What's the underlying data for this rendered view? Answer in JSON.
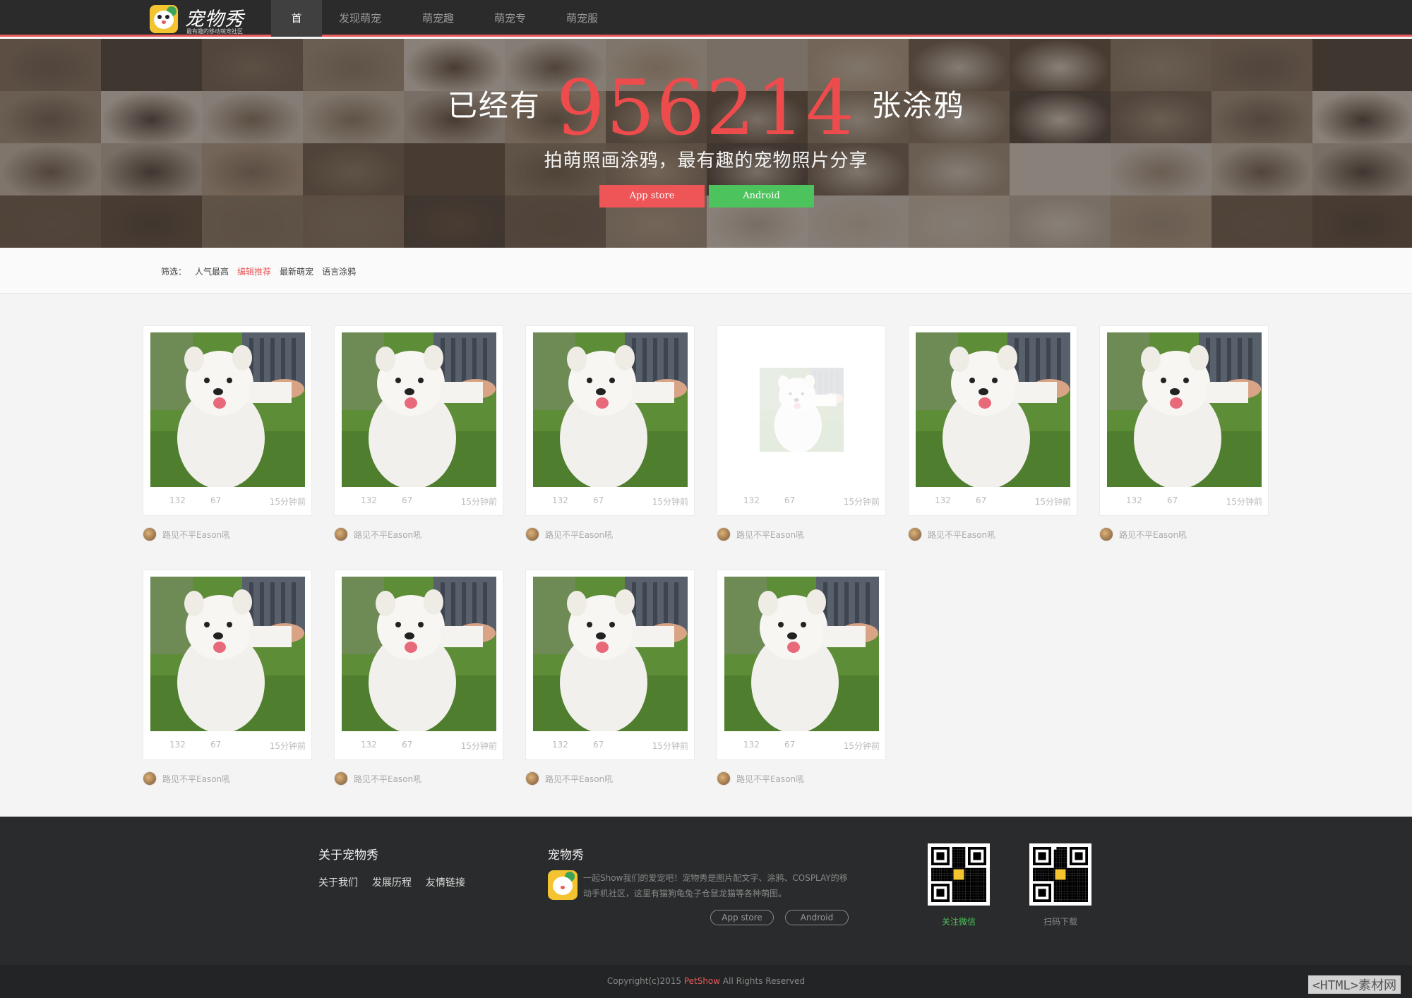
{
  "nav": {
    "logo_title": "宠物秀",
    "logo_sub": "最有趣的移动萌宠社区",
    "items": [
      {
        "label": "首页",
        "active": true
      },
      {
        "label": "发现萌宠"
      },
      {
        "label": "萌宠趣闻"
      },
      {
        "label": "萌宠专题"
      },
      {
        "label": "萌宠服务"
      }
    ],
    "accent": "#e9585a"
  },
  "hero": {
    "prefix": "已经有",
    "count": "956214",
    "suffix": "张涂鸦",
    "tagline": "拍萌照画涂鸦，最有趣的宠物照片分享",
    "btn_ios": "App store",
    "btn_android": "Android",
    "btn_ios_color": "#ee5557",
    "btn_android_color": "#4cc35c"
  },
  "filter": {
    "label": "筛选：",
    "options": [
      "人气最高",
      "编辑推荐",
      "最新萌宠",
      "语言涂鸦"
    ],
    "active_index": 1
  },
  "cards": [
    {
      "likes": "132",
      "comments": "67",
      "time": "15分钟前",
      "author": "路见不平Eason吼"
    },
    {
      "likes": "132",
      "comments": "67",
      "time": "15分钟前",
      "author": "路见不平Eason吼"
    },
    {
      "likes": "132",
      "comments": "67",
      "time": "15分钟前",
      "author": "路见不平Eason吼"
    },
    {
      "likes": "132",
      "comments": "67",
      "time": "15分钟前",
      "author": "路见不平Eason吼"
    },
    {
      "likes": "132",
      "comments": "67",
      "time": "15分钟前",
      "author": "路见不平Eason吼"
    },
    {
      "likes": "132",
      "comments": "67",
      "time": "15分钟前",
      "author": "路见不平Eason吼"
    },
    {
      "likes": "132",
      "comments": "67",
      "time": "15分钟前",
      "author": "路见不平Eason吼"
    },
    {
      "likes": "132",
      "comments": "67",
      "time": "15分钟前",
      "author": "路见不平Eason吼"
    },
    {
      "likes": "132",
      "comments": "67",
      "time": "15分钟前",
      "author": "路见不平Eason吼"
    },
    {
      "likes": "132",
      "comments": "67",
      "time": "15分钟前",
      "author": "路见不平Eason吼"
    }
  ],
  "footer": {
    "about_title": "关于宠物秀",
    "about_links": [
      "关于我们",
      "发展历程",
      "友情链接"
    ],
    "pet_title": "宠物秀",
    "pet_desc": "一起Show我们的爱宠吧！宠物秀是图片配文字、涂鸦、COSPLAY的移动手机社区，这里有猫狗龟兔子仓鼠龙猫等各种萌图。",
    "btn_ios": "App store",
    "btn_android": "Android",
    "qr_wechat_label": "关注微信",
    "qr_download_label": "扫码下载",
    "copyright_pre": "Copyright(c)2015 ",
    "copyright_brand": "PetShow",
    "copyright_post": " All Rights Reserved"
  },
  "corner_mark": "<HTML>素材网"
}
